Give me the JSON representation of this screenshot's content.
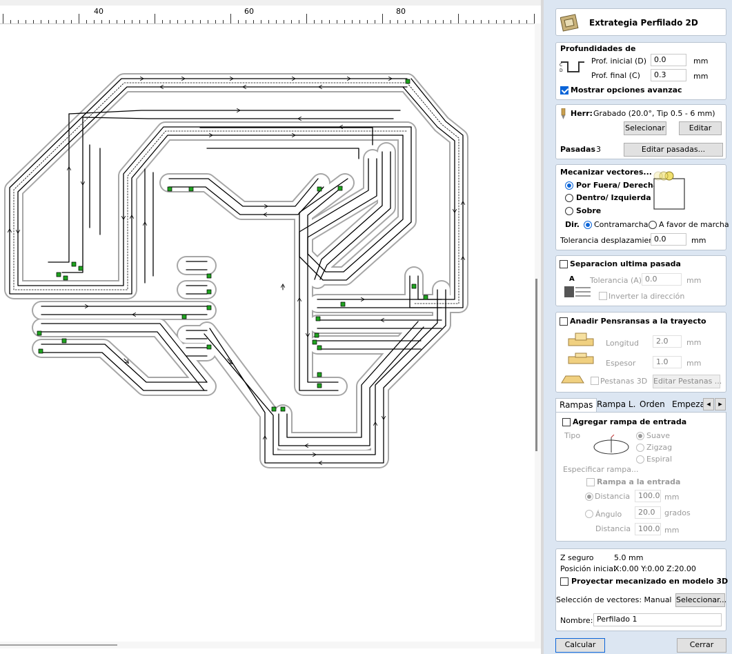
{
  "ruler": {
    "labels": [
      "40",
      "60",
      "80"
    ]
  },
  "panel": {
    "title": "Extrategia Perfilado 2D",
    "depths": {
      "heading": "Profundidades de",
      "start_label": "Prof. inicial (D)",
      "start_value": "0.0",
      "start_unit": "mm",
      "end_label": "Prof. final (C)",
      "end_value": "0.3",
      "end_unit": "mm",
      "show_advanced": "Mostrar opciones avanzac"
    },
    "tool": {
      "label": "Herr:",
      "name": "Grabado (20.0°, Tip 0.5 - 6 mm)",
      "select_btn": "Selecionar",
      "edit_btn": "Editar",
      "passes_label": "Pasadas",
      "passes_value": "3",
      "edit_passes_btn": "Editar pasadas..."
    },
    "machine_vectors": {
      "heading": "Mecanizar vectores...",
      "opt_outside": "Por Fuera/ Derecha",
      "opt_inside": "Dentro/ Izquierda",
      "opt_on": "Sobre",
      "dir_label": "Dir.",
      "dir_climb": "Contramarcha",
      "dir_conventional": "A favor de marcha",
      "tolerance_label": "Tolerancia desplazamiento",
      "tolerance_value": "0.0",
      "tolerance_unit": "mm"
    },
    "last_pass": {
      "heading": "Separacion ultima pasada",
      "tolerance_label": "Tolerancia (A)",
      "tolerance_value": "0.0",
      "tolerance_unit": "mm",
      "invert": "Inverter la dirección"
    },
    "tabs_section": {
      "heading": "Anadir Pensransas a la trayecto",
      "length_label": "Longitud",
      "length_value": "2.0",
      "length_unit": "mm",
      "thickness_label": "Espesor",
      "thickness_value": "1.0",
      "thickness_unit": "mm",
      "tabs3d": "Pestanas 3D",
      "edit_tabs_btn": "Editar Pestanas ..."
    },
    "tabbar": {
      "tabs": [
        "Rampas",
        "Rampa L.",
        "Orden",
        "Empeza"
      ],
      "prev": "◂",
      "next": "▸"
    },
    "ramps": {
      "add_ramp": "Agregar rampa de entrada",
      "type_label": "Tipo",
      "opt_smooth": "Suave",
      "opt_zigzag": "Zigzag",
      "opt_spiral": "Espiral",
      "specify_label": "Especificar rampa...",
      "ramp_entry": "Rampa a la entrada",
      "distance_label": "Distancia",
      "distance_value": "100.0",
      "distance_unit": "mm",
      "angle_label": "Ángulo",
      "angle_value": "20.0",
      "angle_unit": "grados",
      "distance2_label": "Distancia",
      "distance2_value": "100.0",
      "distance2_unit": "mm"
    },
    "footer": {
      "z_safe_label": "Z seguro",
      "z_safe_value": "5.0 mm",
      "home_label": "Posición inicial",
      "home_value": "X:0.00 Y:0.00 Z:20.00",
      "project_3d": "Proyectar mecanizado en modelo 3D",
      "vector_sel_label": "Selección de vectores: Manual",
      "vector_sel_btn": "Seleccionar...",
      "name_label": "Nombre:",
      "name_value": "Perfilado 1",
      "calc_btn": "Calcular",
      "close_btn": "Cerrar"
    }
  }
}
